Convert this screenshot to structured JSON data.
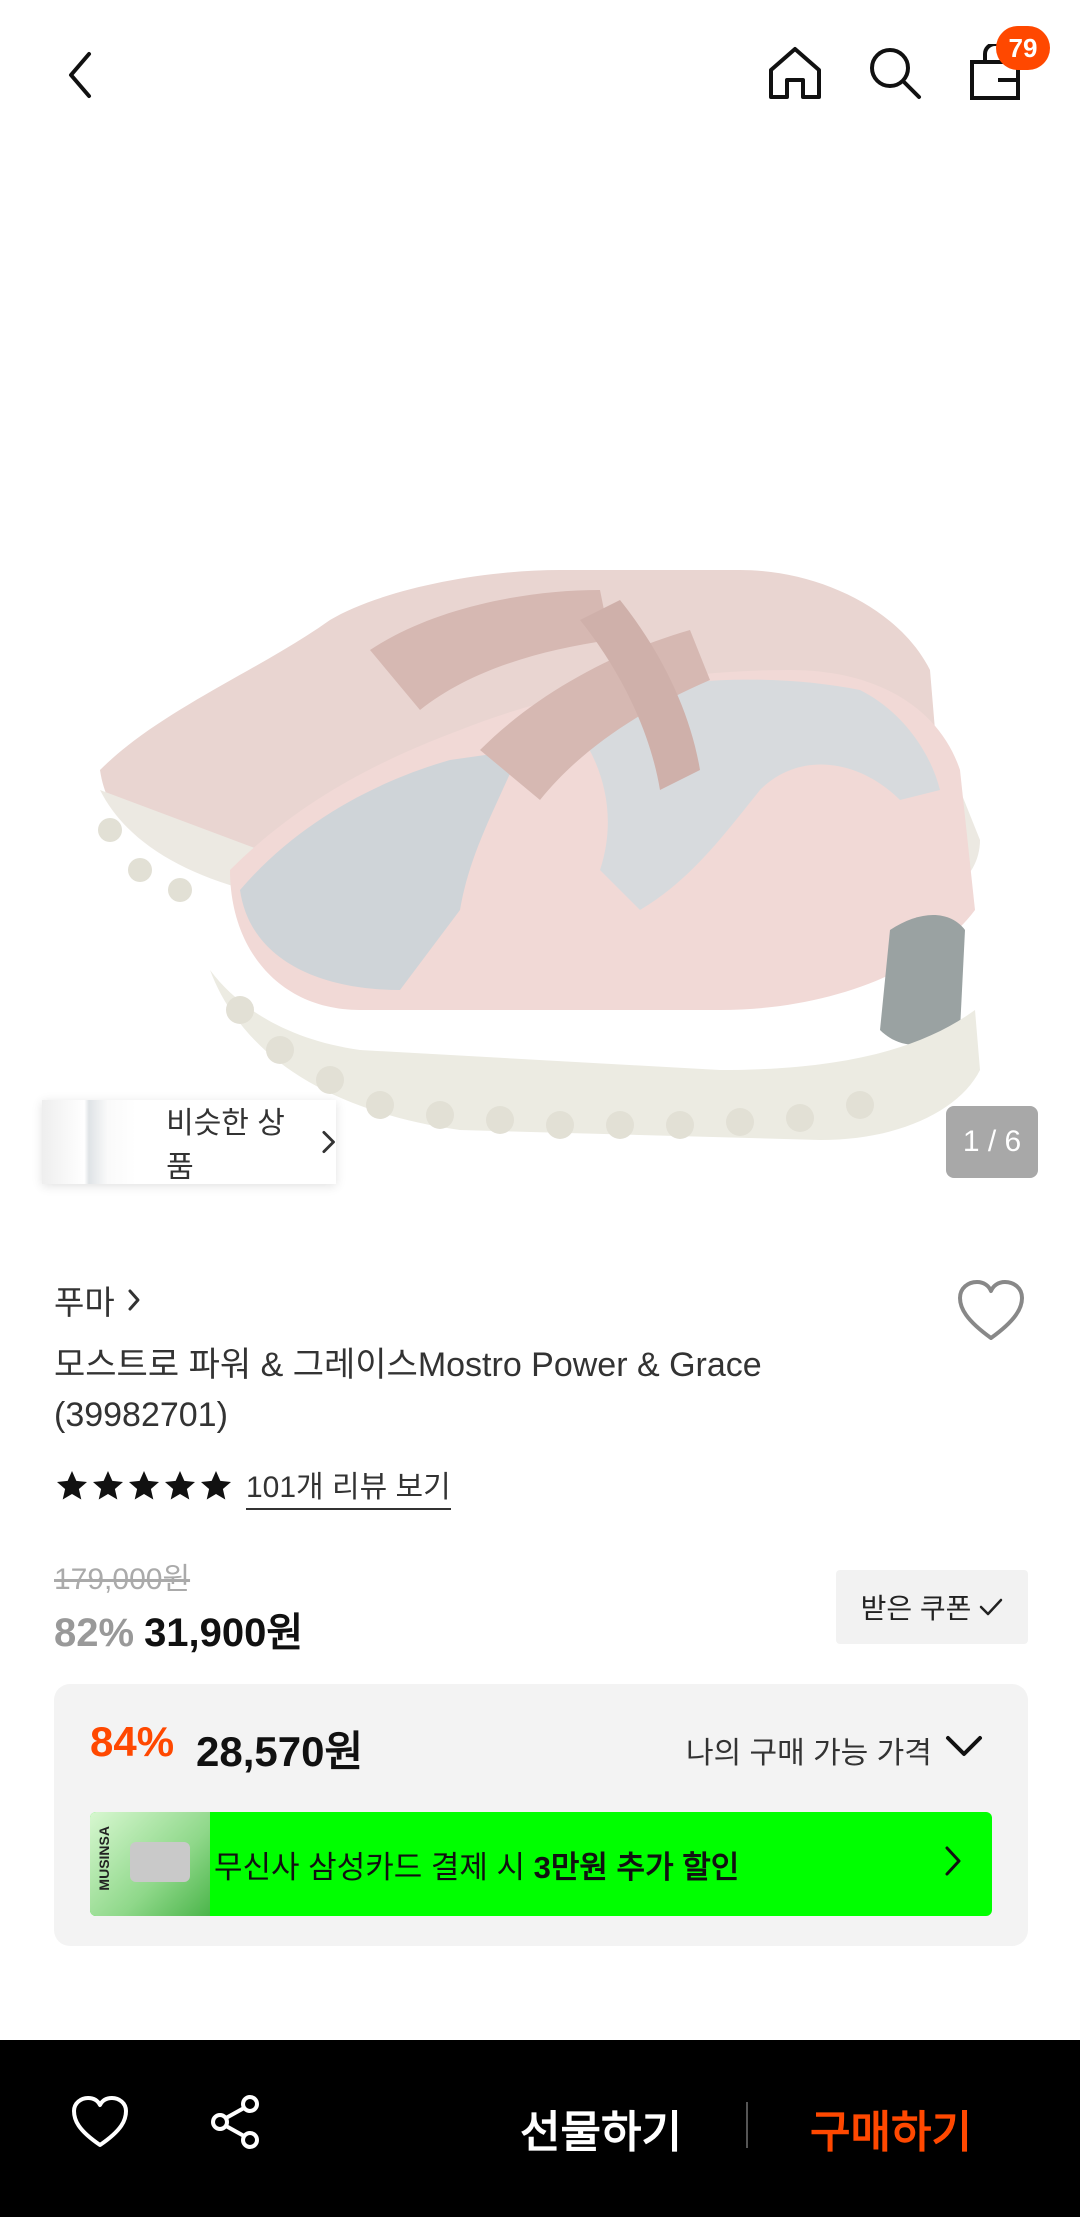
{
  "header": {
    "cart_count": "79",
    "icons": [
      "back-icon",
      "home-icon",
      "search-icon",
      "cart-icon"
    ]
  },
  "gallery": {
    "similar_label": "비슷한 상품",
    "counter": "1 / 6"
  },
  "product": {
    "brand": "푸마",
    "title": "모스트로 파워 & 그레이스Mostro Power & Grace (39982701)",
    "rating_stars": 5,
    "review_link": "101개 리뷰 보기",
    "original_price": "179,000원",
    "discount_pct": "82%",
    "sale_price": "31,900원",
    "coupon_label": "받은 쿠폰"
  },
  "my_price": {
    "pct": "84%",
    "price": "28,570원",
    "label": "나의 구매 가능 가격"
  },
  "card_banner": {
    "card_text": "MUSINSA",
    "text_prefix": "무신사 삼성카드 결제 시 ",
    "text_bold": "3만원 추가 할인"
  },
  "bottom_bar": {
    "gift_label": "선물하기",
    "buy_label": "구매하기"
  },
  "colors": {
    "accent": "#ff4800",
    "banner": "#00ff00"
  }
}
